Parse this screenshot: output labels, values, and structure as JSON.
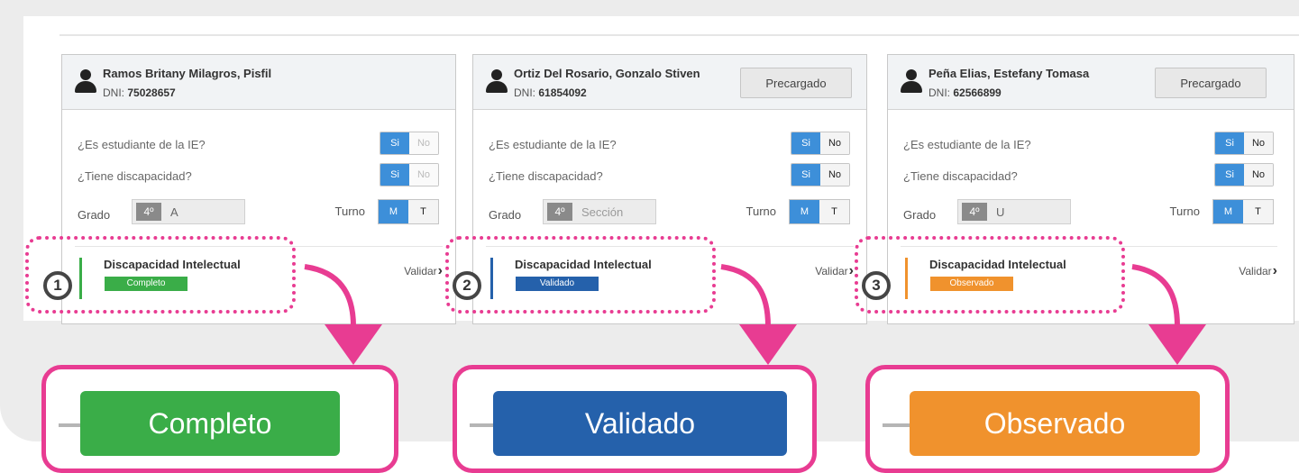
{
  "question_student": "¿Es estudiante de la IE?",
  "question_disability": "¿Tiene discapacidad?",
  "label_grado": "Grado",
  "label_turno": "Turno",
  "yes_label": "Si",
  "no_label": "No",
  "turno_m": "M",
  "turno_t": "T",
  "dni_label": "DNI:",
  "validar_label": "Validar",
  "precargado_label": "Precargado",
  "colors": {
    "completo": "#3aad48",
    "validado": "#2561ab",
    "observado": "#f0922d",
    "highlight": "#e83c92"
  },
  "cards": [
    {
      "name": "Ramos Britany Milagros, Pisfil",
      "dni": "75028657",
      "grado": "4º",
      "seccion": "A",
      "discapacidad": "Discapacidad Intelectual",
      "status": "Completo",
      "number": "1"
    },
    {
      "name": "Ortiz Del Rosario, Gonzalo Stiven",
      "dni": "61854092",
      "grado": "4º",
      "seccion": "Sección",
      "discapacidad": "Discapacidad Intelectual",
      "status": "Validado",
      "number": "2"
    },
    {
      "name": "Peña Elias, Estefany Tomasa",
      "dni": "62566899",
      "grado": "4º",
      "seccion": "U",
      "discapacidad": "Discapacidad Intelectual",
      "status": "Observado",
      "number": "3"
    }
  ],
  "callouts": [
    "Completo",
    "Validado",
    "Observado"
  ]
}
